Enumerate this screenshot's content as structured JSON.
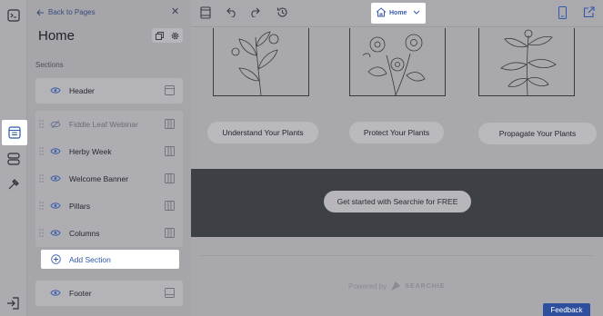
{
  "sidebar_rail": {
    "items": [
      {
        "icon": "panel-toggle-icon"
      },
      {
        "icon": "page-layout-icon",
        "active": true
      },
      {
        "icon": "sections-list-icon"
      },
      {
        "icon": "hammer-icon"
      }
    ],
    "exit_icon": "exit-icon"
  },
  "panel": {
    "back_label": "Back to Pages",
    "title": "Home",
    "sections_heading": "Sections",
    "sections": [
      {
        "label": "Header",
        "visible": true,
        "layout_icon": "header-layout-icon"
      },
      {
        "label": "Fiddle Leaf Webinar",
        "visible": false,
        "layout_icon": "columns-layout-icon"
      },
      {
        "label": "Herby Week",
        "visible": true,
        "layout_icon": "columns-layout-icon"
      },
      {
        "label": "Welcome Banner",
        "visible": true,
        "layout_icon": "columns-layout-icon"
      },
      {
        "label": "Pillars",
        "visible": true,
        "layout_icon": "columns-layout-icon"
      },
      {
        "label": "Columns",
        "visible": true,
        "layout_icon": "columns-layout-icon"
      }
    ],
    "add_section_label": "Add Section",
    "footer_section": {
      "label": "Footer",
      "visible": true,
      "layout_icon": "footer-layout-icon"
    }
  },
  "toolbar": {
    "page_selector": "Home",
    "icons": [
      "layout-icon",
      "undo-icon",
      "redo-icon",
      "history-icon",
      "mobile-preview-icon",
      "open-external-icon"
    ]
  },
  "canvas": {
    "pillars": [
      {
        "button": "Understand Your Plants"
      },
      {
        "button": "Protect Your Plants"
      },
      {
        "button": "Propagate Your Plants"
      }
    ],
    "cta_button": "Get started with Searchie for FREE",
    "powered_by": "Powered by",
    "brand": "SEARCHIE",
    "colors": {
      "cta_band": "#3d4146",
      "accent": "#2d4f9e"
    }
  },
  "feedback_label": "Feedback"
}
